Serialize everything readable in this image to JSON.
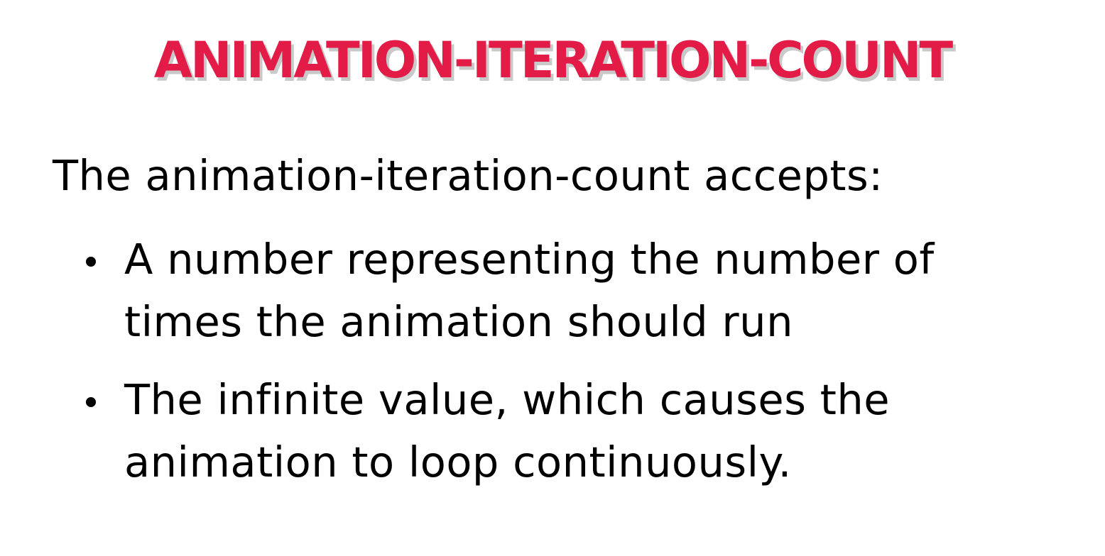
{
  "slide": {
    "title": "ANIMATION-ITERATION-COUNT",
    "intro": "The animation-iteration-count accepts:",
    "bullets": [
      {
        "line1": "A number representing the number of",
        "line2": "times the animation should run"
      },
      {
        "line1": "The infinite value, which causes the",
        "line2": "animation to loop continuously."
      }
    ],
    "colors": {
      "title": "#e21b47",
      "title_shadow": "#c9c9c9",
      "text": "#000000",
      "background": "#ffffff"
    }
  }
}
